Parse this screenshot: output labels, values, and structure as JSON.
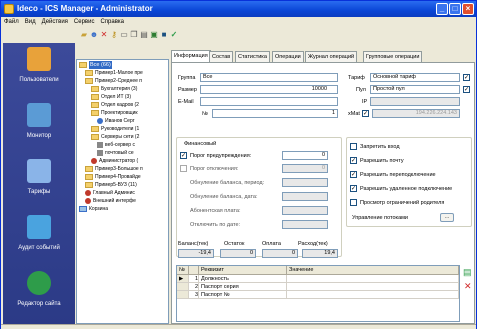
{
  "window": {
    "title": "Ideco - ICS Manager - Administrator"
  },
  "menu": [
    "Файл",
    "Вид",
    "Действия",
    "Сервис",
    "Справка"
  ],
  "toolbar_icons": [
    "folder-icon",
    "user-add-icon",
    "delete-icon",
    "key-icon",
    "window-icon",
    "copy-icon",
    "print-icon",
    "lock-icon",
    "save-icon",
    "apply-icon"
  ],
  "sidebar": [
    {
      "label": "Пользователи",
      "icon": "users-icon",
      "color": "#e8a23a"
    },
    {
      "label": "Монитор",
      "icon": "monitor-icon",
      "color": "#5b9bd5"
    },
    {
      "label": "Тарифы",
      "icon": "calculator-icon",
      "color": "#8ab4e8"
    },
    {
      "label": "Аудит событий",
      "icon": "audit-icon",
      "color": "#4aa3df"
    },
    {
      "label": "Редактор сайта",
      "icon": "globe-icon",
      "color": "#2e9c4a"
    }
  ],
  "tree": [
    {
      "label": "Все (66)",
      "level": 0,
      "kind": "folder",
      "selected": true
    },
    {
      "label": "Пример1-Малое пре",
      "level": 1,
      "kind": "folder"
    },
    {
      "label": "Пример2-Среднее п",
      "level": 1,
      "kind": "folder"
    },
    {
      "label": "Бухгалтерия (3)",
      "level": 2,
      "kind": "folder"
    },
    {
      "label": "Отдел ИТ (3)",
      "level": 2,
      "kind": "folder"
    },
    {
      "label": "Отдел кадров (2",
      "level": 2,
      "kind": "folder"
    },
    {
      "label": "Проектировщик",
      "level": 2,
      "kind": "folder"
    },
    {
      "label": "Иванов Серг",
      "level": 3,
      "kind": "person"
    },
    {
      "label": "Руководители (1",
      "level": 2,
      "kind": "folder"
    },
    {
      "label": "Серверы сети (2",
      "level": 2,
      "kind": "folder"
    },
    {
      "label": "веб-сервер с",
      "level": 3,
      "kind": "server"
    },
    {
      "label": "почтовый се",
      "level": 3,
      "kind": "server"
    },
    {
      "label": "Администратор (",
      "level": 2,
      "kind": "person"
    },
    {
      "label": "Пример3-Большое п",
      "level": 1,
      "kind": "folder"
    },
    {
      "label": "Пример4-Провайде",
      "level": 1,
      "kind": "folder"
    },
    {
      "label": "Пример5-ВУЗ (11)",
      "level": 1,
      "kind": "folder"
    },
    {
      "label": "Главный Админис",
      "level": 1,
      "kind": "person"
    },
    {
      "label": "Внешний интерфе",
      "level": 1,
      "kind": "person"
    },
    {
      "label": "Корзина",
      "level": 0,
      "kind": "trash"
    }
  ],
  "tabs": [
    "Информация",
    "Состав",
    "Статистика",
    "Операции",
    "Журнал операций",
    "Групповые операции"
  ],
  "info": {
    "group_label": "Группа",
    "group_value": "Все",
    "size_label": "Размер",
    "size_value": "10000",
    "email_label": "E-Mail",
    "email_value": "",
    "num_label": "№",
    "num_value": "1",
    "tariff_label": "Тариф",
    "tariff_value": "Основной тариф",
    "pool_label": "Пул",
    "pool_value": "Простой пул",
    "ip_label": "IP",
    "ip_value": "",
    "xmat_label": "xMat",
    "xmat_value": "194.226.224.143",
    "financial_label": "Финансовый",
    "warn_label": "Порог предупреждения:",
    "warn_value": "0",
    "off_label": "Порог отключения:",
    "off_value": "0",
    "reset_period_label": "Обнуление баланса, период:",
    "reset_date_label": "Обнуление баланса, дата:",
    "subscr_label": "Абонентская плата:",
    "disable_date_label": "Отключить по дате:",
    "balance_label": "Баланс(тек)",
    "balance_value": "-19,4",
    "remain_label": "Остаток",
    "remain_value": "0",
    "paid_label": "Оплата",
    "paid_value": "0",
    "expense_label": "Расход(тек)",
    "expense_value": "19,4"
  },
  "options": [
    {
      "label": "Запретить вход",
      "checked": false
    },
    {
      "label": "Разрешить почту",
      "checked": true
    },
    {
      "label": "Разрешить переподключение",
      "checked": true
    },
    {
      "label": "Разрешить удаленное подключение",
      "checked": true
    },
    {
      "label": "Просмотр ограничений родителя",
      "checked": false
    }
  ],
  "limits_label": "Управление потоками",
  "grid": {
    "headers": [
      "№",
      "Реквизит",
      "Значение"
    ],
    "rows": [
      [
        "1",
        "Должность",
        ""
      ],
      [
        "2",
        "Паспорт серия",
        ""
      ],
      [
        "3",
        "Паспорт №",
        ""
      ]
    ]
  }
}
